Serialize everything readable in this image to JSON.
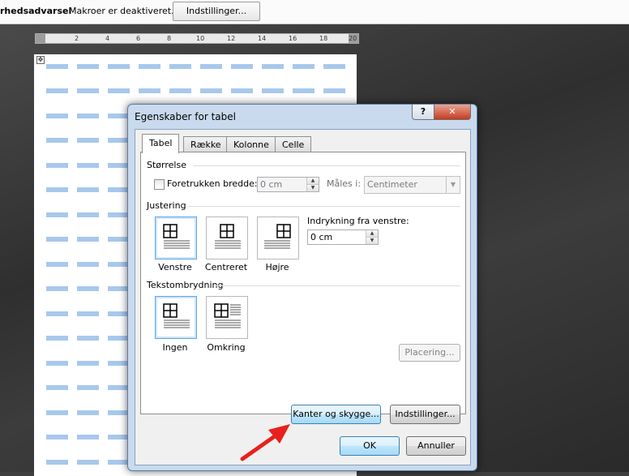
{
  "security_bar": {
    "title": "rhedsadvarsel",
    "message": "Makroer er deaktiveret.",
    "options_button": "Indstillinger..."
  },
  "ruler": {
    "numbers": [
      "2",
      "4",
      "6",
      "8",
      "10",
      "12",
      "14",
      "16",
      "18",
      "20"
    ]
  },
  "dialog": {
    "title": "Egenskaber for tabel",
    "help_button": "?",
    "close_button": "✕",
    "tabs": [
      {
        "label": "Tabel",
        "active": true
      },
      {
        "label": "Række",
        "active": false
      },
      {
        "label": "Kolonne",
        "active": false
      },
      {
        "label": "Celle",
        "active": false
      }
    ],
    "size": {
      "group_label": "Størrelse",
      "preferred_width_label": "Foretrukken bredde:",
      "preferred_width_checked": false,
      "preferred_width_value": "0 cm",
      "measure_label": "Måles i:",
      "measure_value": "Centimeter"
    },
    "alignment": {
      "group_label": "Justering",
      "options": [
        {
          "label": "Venstre",
          "selected": true,
          "icon": "table-align-left-icon"
        },
        {
          "label": "Centreret",
          "selected": false,
          "icon": "table-align-center-icon"
        },
        {
          "label": "Højre",
          "selected": false,
          "icon": "table-align-right-icon"
        }
      ],
      "indent_label": "Indrykning fra venstre:",
      "indent_value": "0 cm"
    },
    "wrapping": {
      "group_label": "Tekstombrydning",
      "options": [
        {
          "label": "Ingen",
          "selected": true,
          "icon": "wrap-none-icon"
        },
        {
          "label": "Omkring",
          "selected": false,
          "icon": "wrap-around-icon"
        }
      ],
      "positioning_button": "Placering..."
    },
    "borders_button": "Kanter og skygge...",
    "options_button": "Indstillinger...",
    "ok_button": "OK",
    "cancel_button": "Annuller"
  },
  "colors": {
    "dialog_frame": "#c9daee",
    "dash_blue": "#a8c8ec",
    "arrow_red": "#e8201c",
    "selected_border": "#5fa6e6"
  }
}
